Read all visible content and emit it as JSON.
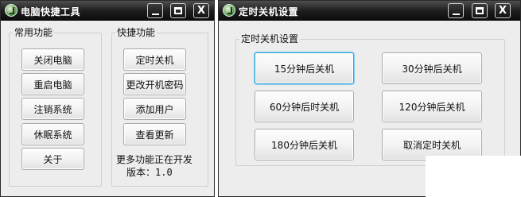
{
  "window1": {
    "title": "电脑快捷工具",
    "common_group": {
      "label": "常用功能",
      "buttons": [
        "关闭电脑",
        "重启电脑",
        "注销系统",
        "休眠系统",
        "关于"
      ]
    },
    "quick_group": {
      "label": "快捷功能",
      "buttons": [
        "定时关机",
        "更改开机密码",
        "添加用户",
        "查看更新"
      ],
      "note": "更多功能正在开发",
      "version": "版本：1.0"
    }
  },
  "window2": {
    "title": "定时关机设置",
    "group": {
      "label": "定时关机设置",
      "buttons": [
        "15分钟后关机",
        "30分钟后关机",
        "60分钟后时关机",
        "120分钟后关机",
        "180分钟后关机",
        "取消定时关机"
      ]
    }
  },
  "titlebar_buttons": {
    "close_glyph": "X"
  }
}
